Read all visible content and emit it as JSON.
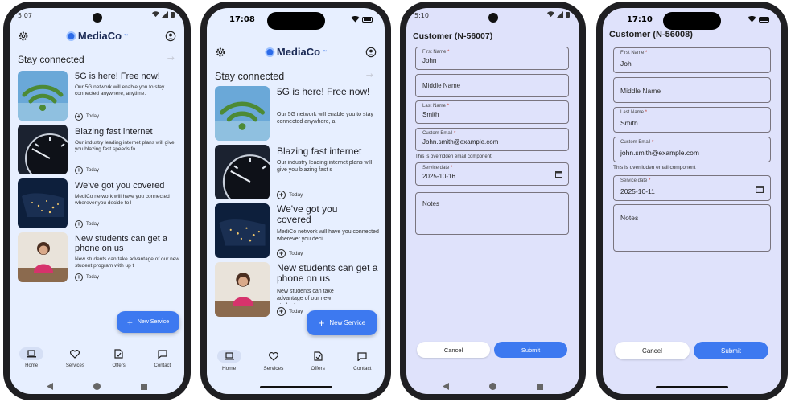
{
  "phones": {
    "p1": {
      "status_time": "5:07",
      "brand": "MediaCo",
      "trademark": "™",
      "section_title": "Stay connected",
      "cards": [
        {
          "title": "5G is here! Free now!",
          "desc": "Our 5G network will enable you to stay connected anywhere, anytime.",
          "meta": "Today"
        },
        {
          "title": "Blazing fast internet",
          "desc": "Our industry leading internet plans will give you blazing fast speeds fo",
          "meta": "Today"
        },
        {
          "title": "We've got you covered",
          "desc": "MediCo network will have you connected wherever you decide to l",
          "meta": "Today"
        },
        {
          "title": "New students can get a phone on us",
          "desc": "New students can take advantage of our new student program with up t",
          "meta": "Today"
        }
      ],
      "fab_label": "New Service",
      "nav": [
        {
          "label": "Home",
          "icon": "laptop-icon",
          "active": true
        },
        {
          "label": "Services",
          "icon": "heart-icon",
          "active": false
        },
        {
          "label": "Offers",
          "icon": "document-check-icon",
          "active": false
        },
        {
          "label": "Contact",
          "icon": "chat-icon",
          "active": false
        }
      ]
    },
    "p2": {
      "status_time": "17:08",
      "brand": "MediaCo",
      "trademark": "™",
      "section_title": "Stay connected",
      "cards": [
        {
          "title": "5G is here! Free now!",
          "desc": "Our 5G network will enable you to stay connected anywhere, a",
          "meta": "Today"
        },
        {
          "title": "Blazing fast internet",
          "desc": "Our industry leading internet plans will give you blazing fast s",
          "meta": "Today"
        },
        {
          "title": "We've got you covered",
          "desc": "MediCo network will have you connected wherever you deci",
          "meta": "Today"
        },
        {
          "title": "New students can get a phone on us",
          "desc": "New students can take advantage of our new student p",
          "meta": "Today"
        }
      ],
      "fab_label": "New Service",
      "nav": [
        {
          "label": "Home",
          "icon": "laptop-icon",
          "active": true
        },
        {
          "label": "Services",
          "icon": "heart-icon",
          "active": false
        },
        {
          "label": "Offers",
          "icon": "document-check-icon",
          "active": false
        },
        {
          "label": "Contact",
          "icon": "chat-icon",
          "active": false
        }
      ]
    },
    "p3": {
      "status_time": "5:10",
      "form_title": "Customer (N-56007)",
      "first_name_label": "First Name",
      "first_name": "John",
      "middle_name_placeholder": "Middle Name",
      "last_name_label": "Last Name",
      "last_name": "Smith",
      "email_label": "Custom Email",
      "email": "John.smith@example.com",
      "email_hint": "This is overridden email component",
      "service_date_label": "Service date",
      "service_date": "2025-10-16",
      "notes_placeholder": "Notes",
      "cancel_label": "Cancel",
      "submit_label": "Submit",
      "required_mark": "*"
    },
    "p4": {
      "status_time": "17:10",
      "form_title": "Customer (N-56008)",
      "first_name_label": "First Name",
      "first_name": "Joh",
      "middle_name_placeholder": "Middle Name",
      "last_name_label": "Last Name",
      "last_name": "Smith",
      "email_label": "Custom Email",
      "email": "john.smith@example.com",
      "email_hint": "This is overridden email component",
      "service_date_label": "Service date",
      "service_date": "2025-10-11",
      "notes_placeholder": "Notes",
      "cancel_label": "Cancel",
      "submit_label": "Submit",
      "required_mark": "*"
    }
  },
  "colors": {
    "accent": "#3d79f0",
    "feed_bg": "#e7efff",
    "form_bg": "#dfe2fb",
    "frame": "#1f1f22"
  }
}
